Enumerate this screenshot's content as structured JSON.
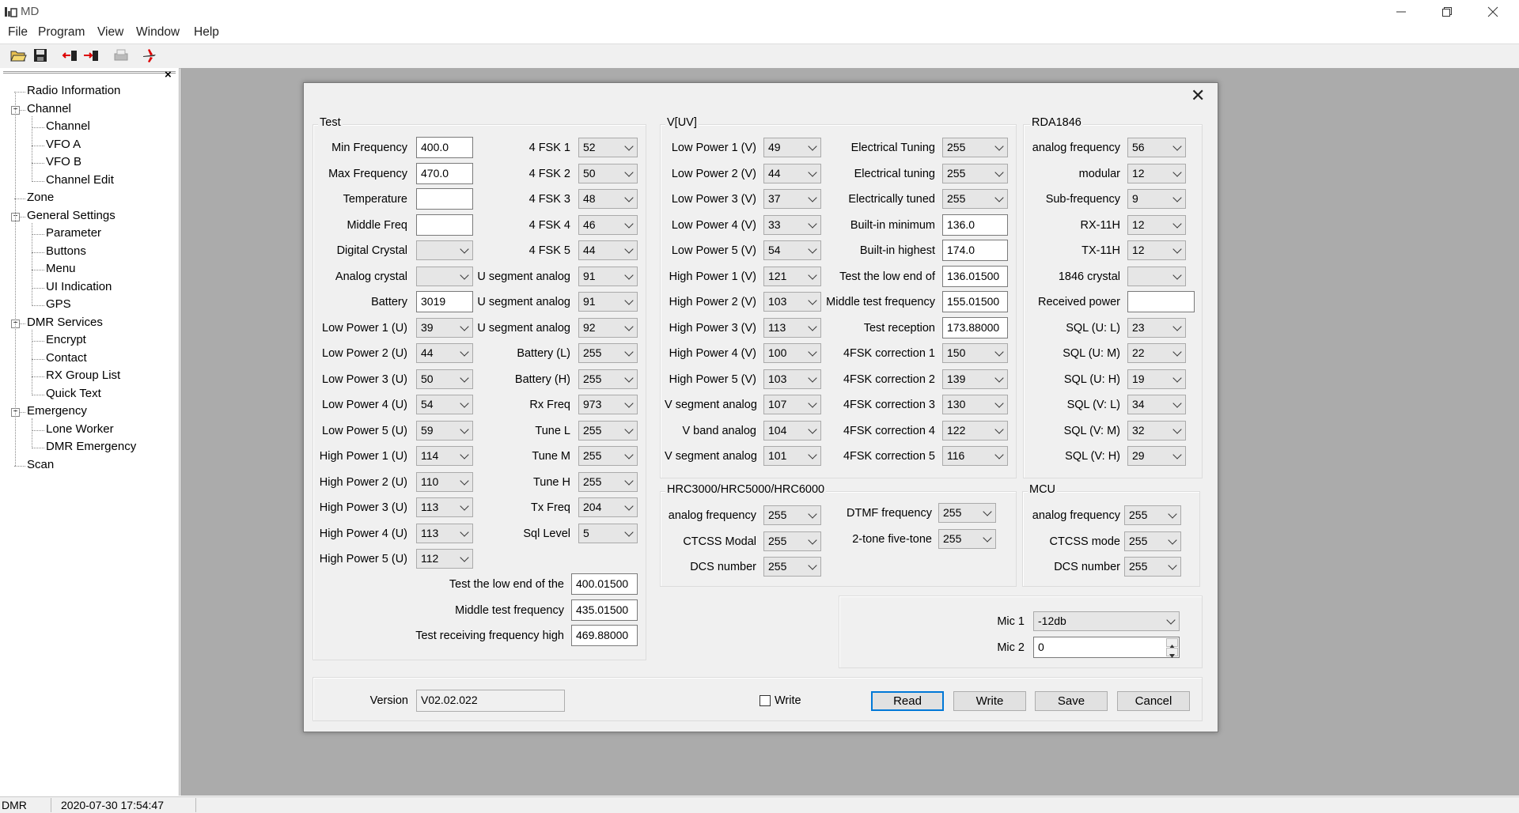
{
  "window": {
    "title": "MD"
  },
  "menu": [
    "File",
    "Program",
    "View",
    "Window",
    "Help"
  ],
  "toolbar": {
    "icons": [
      "open-folder-icon",
      "save-disk-icon",
      "read-radio-icon",
      "write-radio-icon",
      "print-icon",
      "plane-icon"
    ]
  },
  "tree": {
    "close": "×",
    "items": [
      {
        "label": "Radio Information",
        "level": 0
      },
      {
        "label": "Channel",
        "level": 0,
        "expander": "−"
      },
      {
        "label": "Channel",
        "level": 1
      },
      {
        "label": "VFO A",
        "level": 1
      },
      {
        "label": "VFO B",
        "level": 1
      },
      {
        "label": "Channel Edit",
        "level": 1
      },
      {
        "label": "Zone",
        "level": 0
      },
      {
        "label": "General Settings",
        "level": 0,
        "expander": "−"
      },
      {
        "label": "Parameter",
        "level": 1
      },
      {
        "label": "Buttons",
        "level": 1
      },
      {
        "label": "Menu",
        "level": 1
      },
      {
        "label": "UI Indication",
        "level": 1
      },
      {
        "label": "GPS",
        "level": 1
      },
      {
        "label": "DMR Services",
        "level": 0,
        "expander": "−"
      },
      {
        "label": "Encrypt",
        "level": 1
      },
      {
        "label": "Contact",
        "level": 1
      },
      {
        "label": "RX Group List",
        "level": 1
      },
      {
        "label": "Quick Text",
        "level": 1
      },
      {
        "label": "Emergency",
        "level": 0,
        "expander": "−"
      },
      {
        "label": "Lone Worker",
        "level": 1
      },
      {
        "label": "DMR Emergency",
        "level": 1
      },
      {
        "label": "Scan",
        "level": 0
      }
    ]
  },
  "status": {
    "mode": "DMR",
    "datetime": "2020-07-30 17:54:47"
  },
  "dialog": {
    "close": "✕",
    "groups": {
      "test": "Test",
      "vuv": "V[UV]",
      "rda": "RDA1846",
      "hrc": "HRC3000/HRC5000/HRC6000",
      "mcu": "MCU"
    },
    "test_col1": [
      {
        "label": "Min Frequency",
        "type": "text",
        "value": "400.0"
      },
      {
        "label": "Max Frequency",
        "type": "text",
        "value": "470.0"
      },
      {
        "label": "Temperature",
        "type": "text",
        "value": ""
      },
      {
        "label": "Middle Freq",
        "type": "text",
        "value": ""
      },
      {
        "label": "Digital Crystal",
        "type": "select",
        "value": ""
      },
      {
        "label": "Analog crystal",
        "type": "select",
        "value": ""
      },
      {
        "label": "Battery",
        "type": "text",
        "value": "3019"
      },
      {
        "label": "Low Power 1 (U)",
        "type": "select",
        "value": "39"
      },
      {
        "label": "Low Power 2 (U)",
        "type": "select",
        "value": "44"
      },
      {
        "label": "Low Power 3 (U)",
        "type": "select",
        "value": "50"
      },
      {
        "label": "Low Power 4 (U)",
        "type": "select",
        "value": "54"
      },
      {
        "label": "Low Power 5 (U)",
        "type": "select",
        "value": "59"
      },
      {
        "label": "High Power 1 (U)",
        "type": "select",
        "value": "114"
      },
      {
        "label": "High Power 2 (U)",
        "type": "select",
        "value": "110"
      },
      {
        "label": "High Power 3 (U)",
        "type": "select",
        "value": "113"
      },
      {
        "label": "High Power 4 (U)",
        "type": "select",
        "value": "113"
      },
      {
        "label": "High Power 5 (U)",
        "type": "select",
        "value": "112"
      }
    ],
    "test_col2": [
      {
        "label": "4 FSK 1",
        "type": "select",
        "value": "52"
      },
      {
        "label": "4 FSK 2",
        "type": "select",
        "value": "50"
      },
      {
        "label": "4 FSK 3",
        "type": "select",
        "value": "48"
      },
      {
        "label": "4 FSK 4",
        "type": "select",
        "value": "46"
      },
      {
        "label": "4 FSK 5",
        "type": "select",
        "value": "44"
      },
      {
        "label": "U segment analog",
        "type": "select",
        "value": "91"
      },
      {
        "label": "U segment analog",
        "type": "select",
        "value": "91"
      },
      {
        "label": "U segment analog",
        "type": "select",
        "value": "92"
      },
      {
        "label": "Battery (L)",
        "type": "select",
        "value": "255"
      },
      {
        "label": "Battery (H)",
        "type": "select",
        "value": "255"
      },
      {
        "label": "Rx Freq",
        "type": "select",
        "value": "973"
      },
      {
        "label": "Tune L",
        "type": "select",
        "value": "255"
      },
      {
        "label": "Tune M",
        "type": "select",
        "value": "255"
      },
      {
        "label": "Tune H",
        "type": "select",
        "value": "255"
      },
      {
        "label": "Tx Freq",
        "type": "select",
        "value": "204"
      },
      {
        "label": "Sql Level",
        "type": "select",
        "value": "5"
      }
    ],
    "test_bottom": [
      {
        "label": "Test the low end of the",
        "type": "text",
        "value": "400.01500"
      },
      {
        "label": "Middle test frequency",
        "type": "text",
        "value": "435.01500"
      },
      {
        "label": "Test receiving frequency high",
        "type": "text",
        "value": "469.88000"
      }
    ],
    "vuv_col1": [
      {
        "label": "Low Power 1 (V)",
        "type": "select",
        "value": "49"
      },
      {
        "label": "Low Power 2 (V)",
        "type": "select",
        "value": "44"
      },
      {
        "label": "Low Power 3 (V)",
        "type": "select",
        "value": "37"
      },
      {
        "label": "Low Power 4 (V)",
        "type": "select",
        "value": "33"
      },
      {
        "label": "Low Power 5 (V)",
        "type": "select",
        "value": "54"
      },
      {
        "label": "High Power 1 (V)",
        "type": "select",
        "value": "121"
      },
      {
        "label": "High Power 2 (V)",
        "type": "select",
        "value": "103"
      },
      {
        "label": "High Power 3 (V)",
        "type": "select",
        "value": "113"
      },
      {
        "label": "High Power 4 (V)",
        "type": "select",
        "value": "100"
      },
      {
        "label": "High Power 5 (V)",
        "type": "select",
        "value": "103"
      },
      {
        "label": "V segment analog",
        "type": "select",
        "value": "107"
      },
      {
        "label": "V band analog",
        "type": "select",
        "value": "104"
      },
      {
        "label": "V segment analog",
        "type": "select",
        "value": "101"
      }
    ],
    "vuv_col2": [
      {
        "label": "Electrical Tuning",
        "type": "select",
        "value": "255"
      },
      {
        "label": "Electrical tuning",
        "type": "select",
        "value": "255"
      },
      {
        "label": "Electrically tuned",
        "type": "select",
        "value": "255"
      },
      {
        "label": "Built-in minimum",
        "type": "text",
        "value": "136.0"
      },
      {
        "label": "Built-in highest",
        "type": "text",
        "value": "174.0"
      },
      {
        "label": "Test the low end of",
        "type": "text",
        "value": "136.01500"
      },
      {
        "label": "Middle test frequency",
        "type": "text",
        "value": "155.01500"
      },
      {
        "label": "Test reception",
        "type": "text",
        "value": "173.88000"
      },
      {
        "label": "4FSK correction 1",
        "type": "select",
        "value": "150"
      },
      {
        "label": "4FSK correction 2",
        "type": "select",
        "value": "139"
      },
      {
        "label": "4FSK correction 3",
        "type": "select",
        "value": "130"
      },
      {
        "label": "4FSK correction 4",
        "type": "select",
        "value": "122"
      },
      {
        "label": "4FSK correction 5",
        "type": "select",
        "value": "116"
      }
    ],
    "rda": [
      {
        "label": "analog frequency",
        "type": "select",
        "value": "56"
      },
      {
        "label": "modular",
        "type": "select",
        "value": "12"
      },
      {
        "label": "Sub-frequency",
        "type": "select",
        "value": "9"
      },
      {
        "label": "RX-11H",
        "type": "select",
        "value": "12"
      },
      {
        "label": "TX-11H",
        "type": "select",
        "value": "12"
      },
      {
        "label": "1846 crystal",
        "type": "select",
        "value": ""
      },
      {
        "label": "Received power",
        "type": "text",
        "value": ""
      },
      {
        "label": "SQL (U: L)",
        "type": "select",
        "value": "23"
      },
      {
        "label": "SQL (U: M)",
        "type": "select",
        "value": "22"
      },
      {
        "label": "SQL (U: H)",
        "type": "select",
        "value": "19"
      },
      {
        "label": "SQL (V: L)",
        "type": "select",
        "value": "34"
      },
      {
        "label": "SQL (V: M)",
        "type": "select",
        "value": "32"
      },
      {
        "label": "SQL (V: H)",
        "type": "select",
        "value": "29"
      }
    ],
    "hrc_col1": [
      {
        "label": "analog frequency",
        "type": "select",
        "value": "255"
      },
      {
        "label": "CTCSS Modal",
        "type": "select",
        "value": "255"
      },
      {
        "label": "DCS number",
        "type": "select",
        "value": "255"
      }
    ],
    "hrc_col2": [
      {
        "label": "DTMF frequency",
        "type": "select",
        "value": "255"
      },
      {
        "label": "2-tone five-tone",
        "type": "select",
        "value": "255"
      }
    ],
    "mcu": [
      {
        "label": "analog frequency",
        "type": "select",
        "value": "255"
      },
      {
        "label": "CTCSS mode",
        "type": "select",
        "value": "255"
      },
      {
        "label": "DCS number",
        "type": "select",
        "value": "255"
      }
    ],
    "mic": [
      {
        "label": "Mic 1",
        "type": "select",
        "value": "-12db"
      },
      {
        "label": "Mic 2",
        "type": "spin",
        "value": "0"
      }
    ],
    "version": {
      "label": "Version",
      "value": "V02.02.022"
    },
    "write_check": {
      "label": "Write",
      "checked": false
    },
    "buttons": {
      "read": "Read",
      "write": "Write",
      "save": "Save",
      "cancel": "Cancel"
    }
  }
}
